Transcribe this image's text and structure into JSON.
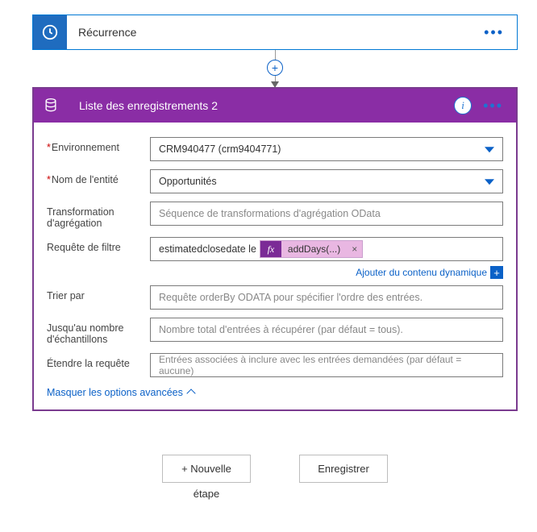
{
  "recurrence": {
    "title": "Récurrence"
  },
  "step2": {
    "title": "Liste des enregistrements 2",
    "fields": {
      "environment": {
        "label": "Environnement",
        "value": "CRM940477 (crm9404771)",
        "required": true
      },
      "entity": {
        "label": "Nom de l'entité",
        "value": "Opportunités",
        "required": true
      },
      "aggregation": {
        "label": "Transformation d'agrégation",
        "placeholder": "Séquence de transformations d'agrégation OData"
      },
      "filter": {
        "label": "Requête de filtre",
        "text_prefix": "estimatedclosedate le",
        "pill_fx": "fx",
        "pill_label": "addDays(...)"
      },
      "orderby": {
        "label": "Trier par",
        "placeholder": "Requête orderBy ODATA pour spécifier l'ordre des entrées."
      },
      "top": {
        "label": "Jusqu'au nombre d'échantillons",
        "placeholder": "Nombre total d'entrées à récupérer (par défaut = tous)."
      },
      "expand": {
        "label": "Étendre la requête",
        "placeholder": "Entrées associées à inclure avec les entrées demandées (par défaut = aucune)"
      }
    },
    "dynamic_link": "Ajouter du contenu dynamique",
    "hide_advanced": "Masquer les options avancées"
  },
  "footer": {
    "new_step_line1": "+ Nouvelle",
    "new_step_line2": "étape",
    "save": "Enregistrer"
  }
}
